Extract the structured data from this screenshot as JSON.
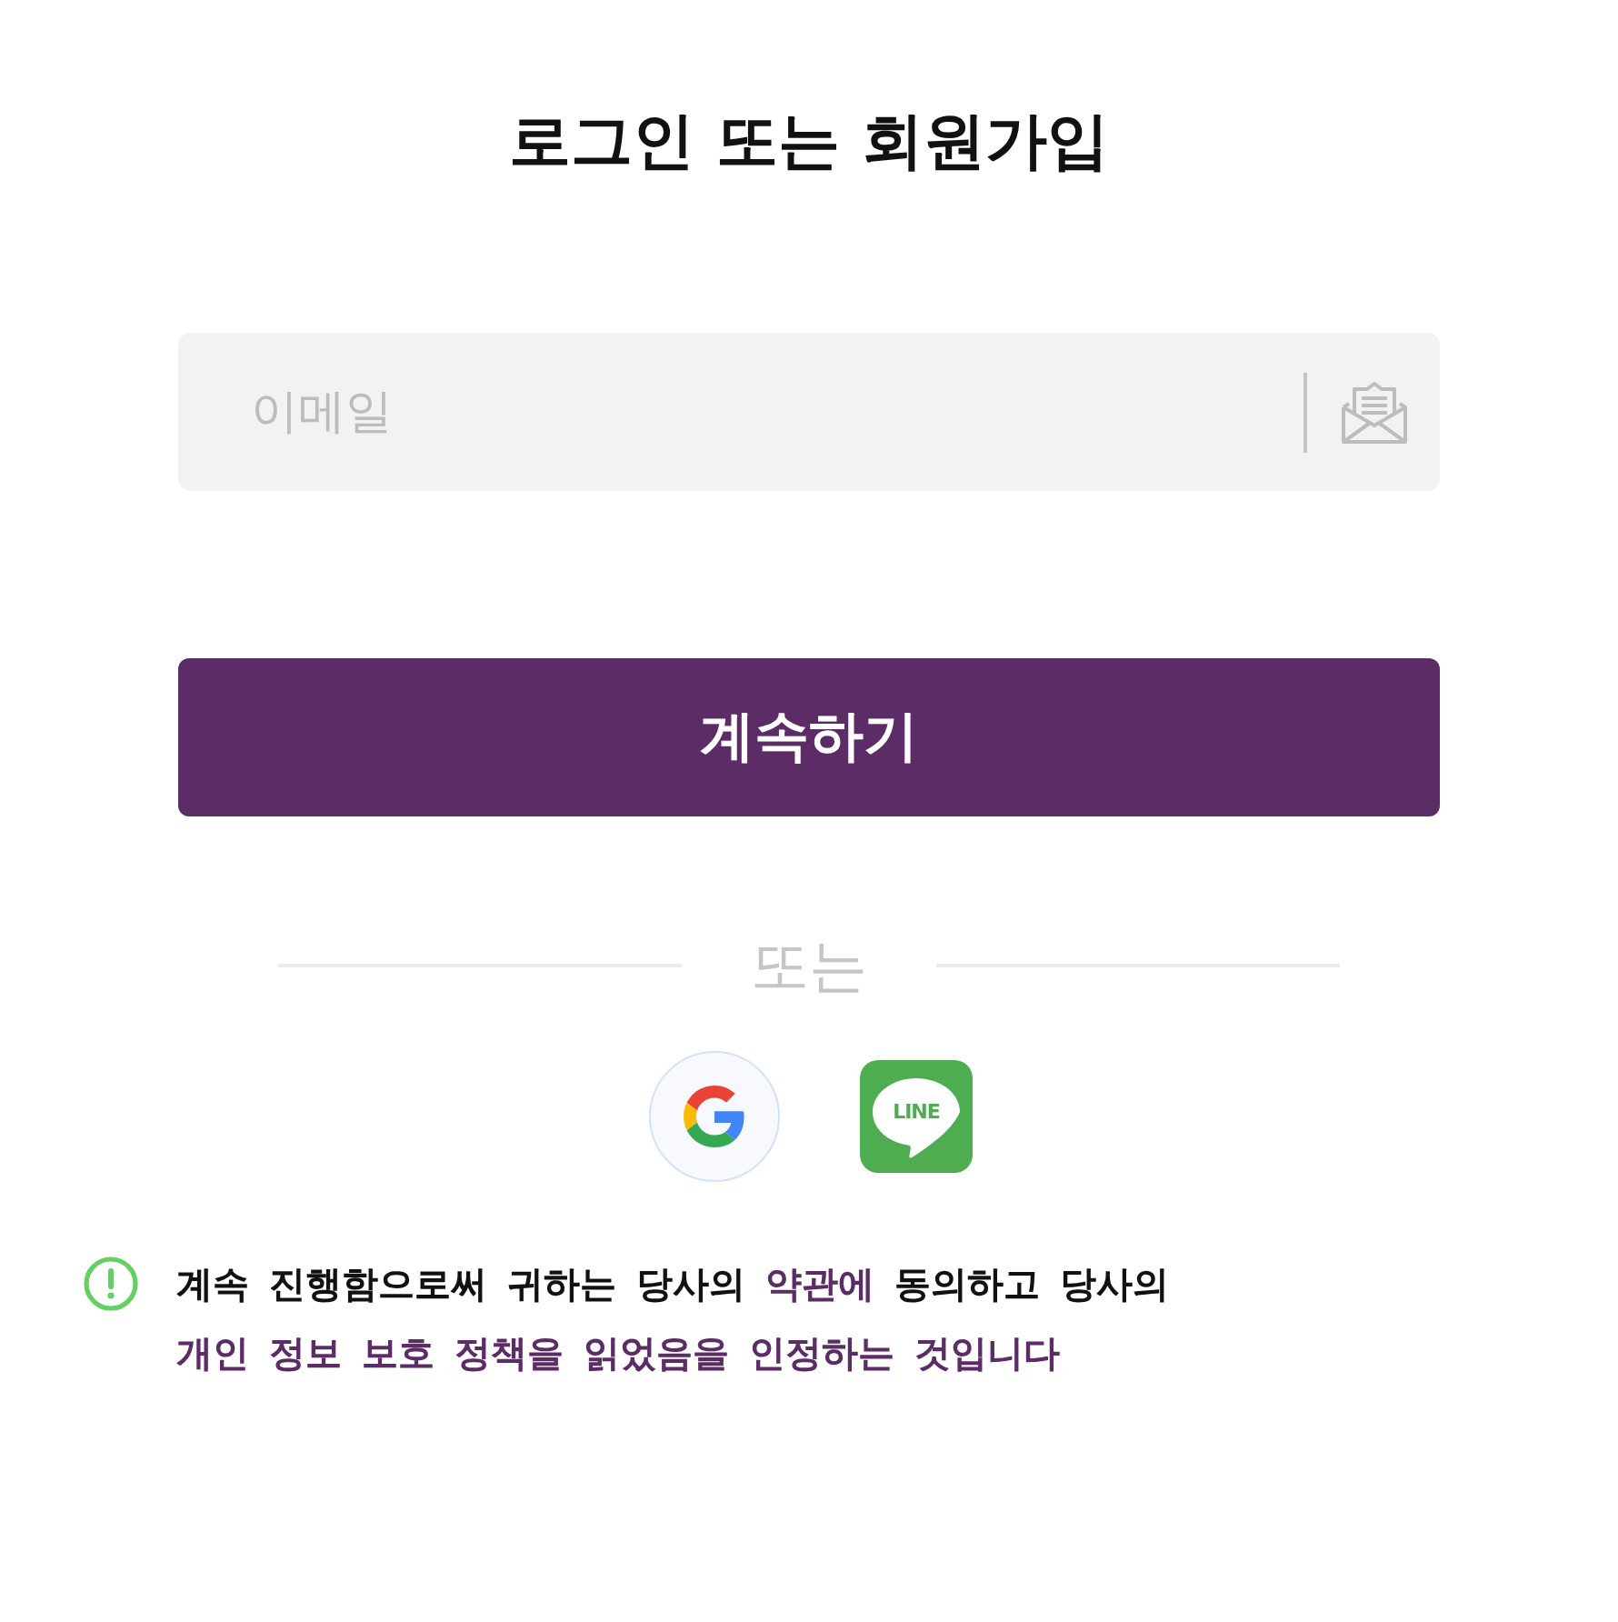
{
  "title": "로그인 또는 회원가입",
  "email_field": {
    "placeholder": "이메일"
  },
  "continue_button": {
    "label": "계속하기"
  },
  "separator": {
    "label": "또는"
  },
  "social_logins": [
    {
      "kind": "google"
    },
    {
      "kind": "line",
      "label": "LINE"
    }
  ],
  "notice": {
    "parts": [
      {
        "kind": "text",
        "text": "계속 진행함으로써 귀하는 당사의"
      },
      {
        "kind": "link",
        "text": "약관에"
      },
      {
        "kind": "text",
        "text": "동의하고 당사의"
      },
      {
        "kind": "link",
        "text": "개인 정보 보호 정책을 읽었음을 인정하는 것입니다"
      }
    ]
  }
}
